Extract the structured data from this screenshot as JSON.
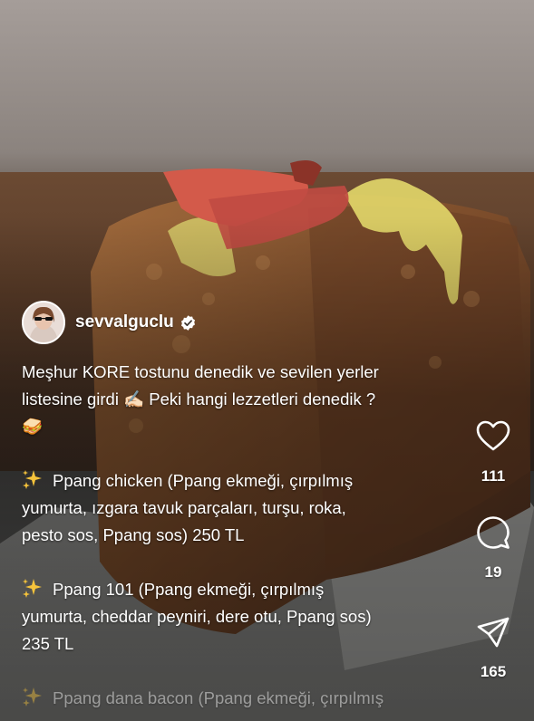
{
  "post": {
    "username": "sevvalguclu",
    "verified": true,
    "caption_lines": [
      "Meşhur KORE tostunu denedik ve sevilen yerler",
      "listesine girdi ✍🏻 Peki hangi lezzetleri denedik ?",
      "🥪"
    ],
    "items": [
      {
        "icon": "sparkles-icon",
        "lines": [
          "Ppang chicken (Ppang ekmeği, çırpılmış",
          "yumurta, ızgara tavuk parçaları, turşu, roka,",
          "pesto sos, Ppang sos) 250 TL"
        ]
      },
      {
        "icon": "sparkles-icon",
        "lines": [
          "Ppang 101 (Ppang ekmeği, çırpılmış",
          "yumurta, cheddar peyniri, dere otu, Ppang sos)",
          "235 TL"
        ]
      },
      {
        "icon": "sparkles-icon",
        "lines": [
          "Ppang dana bacon (Ppang ekmeği, çırpılmış"
        ]
      }
    ]
  },
  "actions": {
    "like": {
      "icon": "heart-icon",
      "count": "111"
    },
    "comment": {
      "icon": "comment-icon",
      "count": "19"
    },
    "share": {
      "icon": "send-icon",
      "count": "165"
    }
  },
  "colors": {
    "text": "#ffffff",
    "verified_badge": "#ffffff",
    "sparkle": "#f5c33b"
  }
}
